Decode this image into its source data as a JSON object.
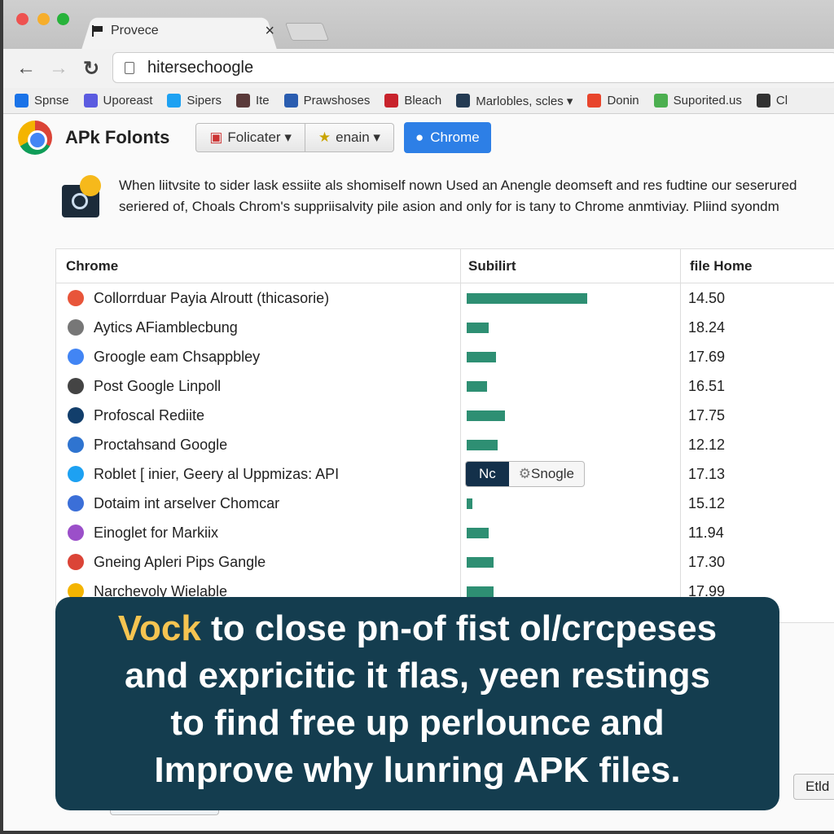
{
  "browser": {
    "tab_title": "Provece",
    "address": "hitersechoogle",
    "bookmarks": [
      {
        "label": "Spnse",
        "color": "#1a73e8"
      },
      {
        "label": "Uporeast",
        "color": "#5b5be0"
      },
      {
        "label": "Sipers",
        "color": "#1da1f2"
      },
      {
        "label": "Ite",
        "color": "#5a3a3a"
      },
      {
        "label": "Prawshoses",
        "color": "#2a5db0"
      },
      {
        "label": "Bleach",
        "color": "#c8232c"
      },
      {
        "label": "Marlobles, scles ▾",
        "color": "#243b53"
      },
      {
        "label": "Donin",
        "color": "#e8452c"
      },
      {
        "label": "Suporited.us",
        "color": "#4caf50"
      },
      {
        "label": "Cl",
        "color": "#333333"
      }
    ]
  },
  "header": {
    "app_title": "APk Folonts",
    "segment": [
      "Folicater ▾",
      "enain ▾"
    ],
    "chrome_button": "Chrome"
  },
  "info": {
    "line1": "When liitvsite to sider lask essiite als shomiself nown Used an Anengle deomseft and res fudtine our seserured",
    "line2": "seriered of, Choals Chrom's suppriisalvity pile asion and only for is tany to Chrome anmtiviay. Pliind syondm"
  },
  "table": {
    "columns": [
      "Chrome",
      "Subilirt",
      "file Home"
    ],
    "bar_color": "#2e8f73",
    "rows": [
      {
        "name": "Collorrduar Payia Alroutt (thicasorie)",
        "bar": 1.0,
        "value": "14.50",
        "icon_color": "#e8553a"
      },
      {
        "name": "Aytics AFiamblecbung",
        "bar": 0.18,
        "value": "18.24",
        "icon_color": "#777777"
      },
      {
        "name": "Groogle eam Chsappbley",
        "bar": 0.24,
        "value": "17.69",
        "icon_color": "#4285f4"
      },
      {
        "name": "Post Google Linpoll",
        "bar": 0.17,
        "value": "16.51",
        "icon_color": "#444444"
      },
      {
        "name": "Profoscal Rediite",
        "bar": 0.32,
        "value": "17.75",
        "icon_color": "#123e6b"
      },
      {
        "name": "Proctahsand Google",
        "bar": 0.26,
        "value": "12.12",
        "icon_color": "#2f74d0"
      },
      {
        "name": "Roblet [ inier, Geery al Uppmizas: API",
        "bar": null,
        "value": "17.13",
        "icon_color": "#1da1f2",
        "toggle": [
          "Nc",
          "Snogle"
        ]
      },
      {
        "name": "Dotaim int arselver Chomcar",
        "bar": 0.05,
        "value": "15.12",
        "icon_color": "#3b6fd8"
      },
      {
        "name": "Einoglet for Markiix",
        "bar": 0.18,
        "value": "11.94",
        "icon_color": "#9b4fc9"
      },
      {
        "name": "Gneing Apleri Pips Gangle",
        "bar": 0.22,
        "value": "17.30",
        "icon_color": "#db4437"
      },
      {
        "name": "Narchevoly Wielable",
        "bar": 0.22,
        "value": "17.99",
        "icon_color": "#f4b400"
      }
    ]
  },
  "overlay": {
    "highlight": "Vock",
    "line1_rest": " to close pn-of fist ol/crcpeses",
    "line2": "and expricitic it flas, yeen restings",
    "line3": "to find free up perlounce and",
    "line4": "Improve why lunring APK files."
  },
  "footer": {
    "button": "Etld"
  }
}
